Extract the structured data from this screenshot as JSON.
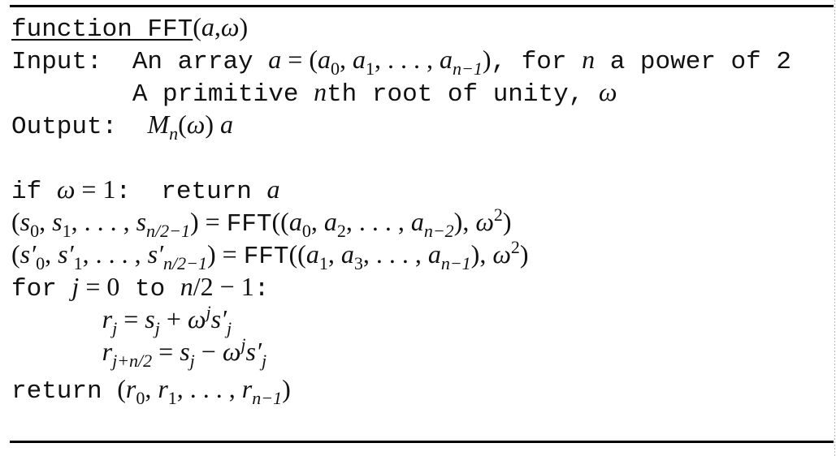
{
  "algorithm": {
    "lines": [
      [
        {
          "t": "function FFT",
          "k": "m u"
        },
        {
          "t": "(",
          "k": "r"
        },
        {
          "t": "a",
          "k": "i"
        },
        {
          "t": ",",
          "k": "r"
        },
        {
          "t": "ω",
          "k": "i"
        },
        {
          "t": ")",
          "k": "r"
        }
      ],
      [
        {
          "t": "Input:  An array ",
          "k": "m"
        },
        {
          "t": "a",
          "k": "i"
        },
        {
          "t": " = (",
          "k": "r"
        },
        {
          "t": "a",
          "k": "i"
        },
        {
          "t": "0",
          "k": "sub"
        },
        {
          "t": ", ",
          "k": "r"
        },
        {
          "t": "a",
          "k": "i"
        },
        {
          "t": "1",
          "k": "sub"
        },
        {
          "t": ", . . . , ",
          "k": "r"
        },
        {
          "t": "a",
          "k": "i"
        },
        {
          "t": "n−1",
          "k": "subi"
        },
        {
          "t": ")",
          "k": "r"
        },
        {
          "t": ", for ",
          "k": "m"
        },
        {
          "t": "n",
          "k": "i"
        },
        {
          "t": " a power of 2",
          "k": "m"
        }
      ],
      [
        {
          "t": "        A primitive ",
          "k": "m"
        },
        {
          "t": "n",
          "k": "i"
        },
        {
          "t": "th root of unity, ",
          "k": "m"
        },
        {
          "t": "ω",
          "k": "i"
        }
      ],
      [
        {
          "t": "Output:  ",
          "k": "m"
        },
        {
          "t": "M",
          "k": "i"
        },
        {
          "t": "n",
          "k": "subi"
        },
        {
          "t": "(",
          "k": "r"
        },
        {
          "t": "ω",
          "k": "i"
        },
        {
          "t": ") ",
          "k": "r"
        },
        {
          "t": "a",
          "k": "i"
        }
      ],
      [
        {
          "t": " ",
          "k": "m"
        }
      ],
      [
        {
          "t": "if ",
          "k": "m"
        },
        {
          "t": "ω",
          "k": "i"
        },
        {
          "t": " = 1",
          "k": "r"
        },
        {
          "t": ":  return ",
          "k": "m"
        },
        {
          "t": "a",
          "k": "i"
        }
      ],
      [
        {
          "t": "(",
          "k": "r"
        },
        {
          "t": "s",
          "k": "i"
        },
        {
          "t": "0",
          "k": "sub"
        },
        {
          "t": ", ",
          "k": "r"
        },
        {
          "t": "s",
          "k": "i"
        },
        {
          "t": "1",
          "k": "sub"
        },
        {
          "t": ", . . . , ",
          "k": "r"
        },
        {
          "t": "s",
          "k": "i"
        },
        {
          "t": "n/2−1",
          "k": "subi"
        },
        {
          "t": ") = ",
          "k": "r"
        },
        {
          "t": "FFT",
          "k": "m"
        },
        {
          "t": "((",
          "k": "r"
        },
        {
          "t": "a",
          "k": "i"
        },
        {
          "t": "0",
          "k": "sub"
        },
        {
          "t": ", ",
          "k": "r"
        },
        {
          "t": "a",
          "k": "i"
        },
        {
          "t": "2",
          "k": "sub"
        },
        {
          "t": ", . . . , ",
          "k": "r"
        },
        {
          "t": "a",
          "k": "i"
        },
        {
          "t": "n−2",
          "k": "subi"
        },
        {
          "t": "), ",
          "k": "r"
        },
        {
          "t": "ω",
          "k": "i"
        },
        {
          "t": "2",
          "k": "sup"
        },
        {
          "t": ")",
          "k": "r"
        }
      ],
      [
        {
          "t": "(",
          "k": "r"
        },
        {
          "t": "s′",
          "k": "i"
        },
        {
          "t": "0",
          "k": "sub"
        },
        {
          "t": ", ",
          "k": "r"
        },
        {
          "t": "s′",
          "k": "i"
        },
        {
          "t": "1",
          "k": "sub"
        },
        {
          "t": ", . . . , ",
          "k": "r"
        },
        {
          "t": "s′",
          "k": "i"
        },
        {
          "t": "n/2−1",
          "k": "subi"
        },
        {
          "t": ") = ",
          "k": "r"
        },
        {
          "t": "FFT",
          "k": "m"
        },
        {
          "t": "((",
          "k": "r"
        },
        {
          "t": "a",
          "k": "i"
        },
        {
          "t": "1",
          "k": "sub"
        },
        {
          "t": ", ",
          "k": "r"
        },
        {
          "t": "a",
          "k": "i"
        },
        {
          "t": "3",
          "k": "sub"
        },
        {
          "t": ", . . . , ",
          "k": "r"
        },
        {
          "t": "a",
          "k": "i"
        },
        {
          "t": "n−1",
          "k": "subi"
        },
        {
          "t": "), ",
          "k": "r"
        },
        {
          "t": "ω",
          "k": "i"
        },
        {
          "t": "2",
          "k": "sup"
        },
        {
          "t": ")",
          "k": "r"
        }
      ],
      [
        {
          "t": "for ",
          "k": "m"
        },
        {
          "t": "j",
          "k": "i"
        },
        {
          "t": " = 0",
          "k": "r"
        },
        {
          "t": " to ",
          "k": "m"
        },
        {
          "t": "n",
          "k": "i"
        },
        {
          "t": "/2 − 1",
          "k": "r"
        },
        {
          "t": ":",
          "k": "m"
        }
      ],
      [
        {
          "t": "      ",
          "k": "m"
        },
        {
          "t": "r",
          "k": "i"
        },
        {
          "t": "j",
          "k": "subi"
        },
        {
          "t": " = ",
          "k": "r"
        },
        {
          "t": "s",
          "k": "i"
        },
        {
          "t": "j",
          "k": "subi"
        },
        {
          "t": " + ",
          "k": "r"
        },
        {
          "t": "ω",
          "k": "i"
        },
        {
          "t": "j",
          "k": "supi"
        },
        {
          "t": "s′",
          "k": "i"
        },
        {
          "t": "j",
          "k": "subi"
        }
      ],
      [
        {
          "t": "      ",
          "k": "m"
        },
        {
          "t": "r",
          "k": "i"
        },
        {
          "t": "j+n/2",
          "k": "subi"
        },
        {
          "t": " = ",
          "k": "r"
        },
        {
          "t": "s",
          "k": "i"
        },
        {
          "t": "j",
          "k": "subi"
        },
        {
          "t": " − ",
          "k": "r"
        },
        {
          "t": "ω",
          "k": "i"
        },
        {
          "t": "j",
          "k": "supi"
        },
        {
          "t": "s′",
          "k": "i"
        },
        {
          "t": "j",
          "k": "subi"
        }
      ],
      [
        {
          "t": "return ",
          "k": "m"
        },
        {
          "t": "(",
          "k": "r"
        },
        {
          "t": "r",
          "k": "i"
        },
        {
          "t": "0",
          "k": "sub"
        },
        {
          "t": ", ",
          "k": "r"
        },
        {
          "t": "r",
          "k": "i"
        },
        {
          "t": "1",
          "k": "sub"
        },
        {
          "t": ", . . . , ",
          "k": "r"
        },
        {
          "t": "r",
          "k": "i"
        },
        {
          "t": "n−1",
          "k": "subi"
        },
        {
          "t": ")",
          "k": "r"
        }
      ]
    ]
  }
}
